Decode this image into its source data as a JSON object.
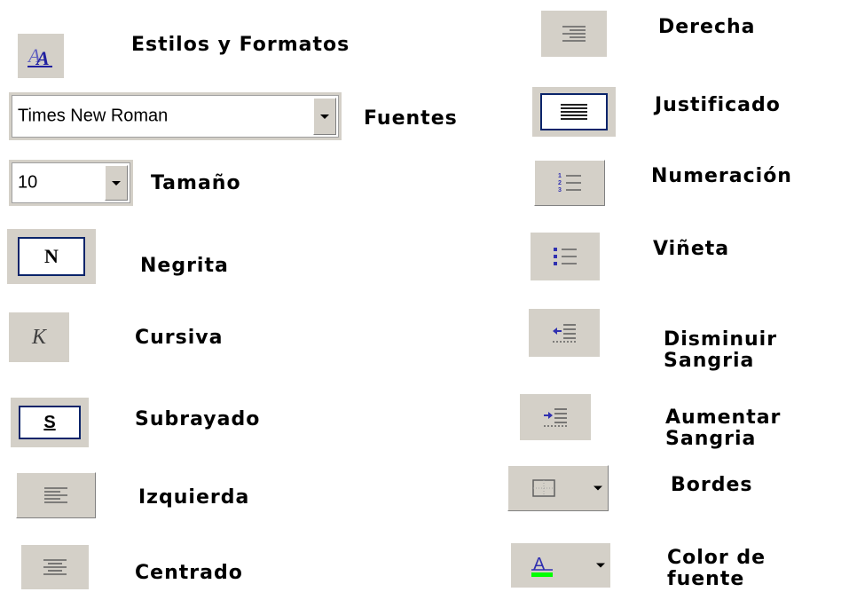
{
  "items": {
    "estilos": "Estilos y Formatos",
    "fuentes": "Fuentes",
    "tamano": "Tamaño",
    "negrita": "Negrita",
    "cursiva": "Cursiva",
    "subrayado": "Subrayado",
    "izquierda": "Izquierda",
    "centrado": "Centrado",
    "derecha": "Derecha",
    "justificado": "Justificado",
    "numeracion": "Numeración",
    "vineta": "Viñeta",
    "disminuir_line1": "Disminuir",
    "disminuir_line2": "Sangria",
    "aumentar_line1": "Aumentar",
    "aumentar_line2": "Sangria",
    "bordes": "Bordes",
    "color_line1": "Color de",
    "color_line2": "fuente"
  },
  "font_combo": {
    "value": "Times New Roman"
  },
  "size_combo": {
    "value": "10"
  },
  "button_glyphs": {
    "bold": "N",
    "italic": "K",
    "underline": "S"
  },
  "colors": {
    "toolbar_face": "#d4d0c8",
    "pressed_border": "#0a246a",
    "icon_blue": "#3030b0",
    "font_color_bar": "#00ff00"
  }
}
